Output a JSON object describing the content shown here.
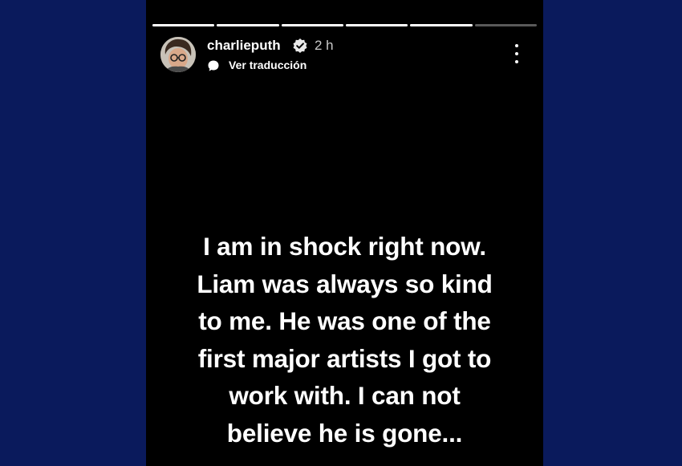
{
  "story": {
    "progress": {
      "segments": 6,
      "completed": 5
    },
    "user": {
      "username": "charlieputh",
      "verified": true,
      "time": "2 h"
    },
    "translate_label": "Ver traducción",
    "message_lines": [
      "I am in shock right now.",
      "Liam was always so kind",
      "to me. He was one of the",
      "first major artists I got to",
      "work with. I can not",
      "believe he is gone..."
    ]
  },
  "icons": {
    "verified": "verified-badge-icon",
    "translate": "speech-bubble-icon",
    "more": "more-vertical-icon"
  },
  "colors": {
    "page_bg": "#0a1a5c",
    "story_bg": "#000000",
    "text": "#ffffff",
    "muted": "#c9c9c9"
  }
}
